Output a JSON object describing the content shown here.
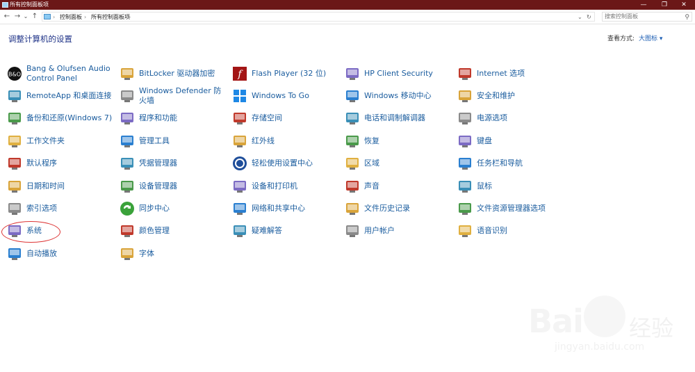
{
  "window": {
    "title": "所有控制面板项"
  },
  "nav": {
    "back": "←",
    "forward": "→",
    "recent": "⌄",
    "up": "↑"
  },
  "address": {
    "crumbs": [
      "控制面板",
      "所有控制面板项"
    ],
    "separator": "›",
    "dropdown": "⌄",
    "refresh": "↻"
  },
  "search": {
    "placeholder": "搜索控制面板"
  },
  "page": {
    "heading": "调整计算机的设置",
    "view_label": "查看方式:",
    "view_value": "大图标 ▾"
  },
  "items": [
    [
      "Bang & Olufsen Audio Control Panel",
      "BitLocker 驱动器加密",
      "Flash Player (32 位)",
      "HP Client Security",
      "Internet 选项"
    ],
    [
      "RemoteApp 和桌面连接",
      "Windows Defender 防火墙",
      "Windows To Go",
      "Windows 移动中心",
      "安全和维护"
    ],
    [
      "备份和还原(Windows 7)",
      "程序和功能",
      "存储空间",
      "电话和调制解调器",
      "电源选项"
    ],
    [
      "工作文件夹",
      "管理工具",
      "红外线",
      "恢复",
      "键盘"
    ],
    [
      "默认程序",
      "凭据管理器",
      "轻松使用设置中心",
      "区域",
      "任务栏和导航"
    ],
    [
      "日期和时间",
      "设备管理器",
      "设备和打印机",
      "声音",
      "鼠标"
    ],
    [
      "索引选项",
      "同步中心",
      "网络和共享中心",
      "文件历史记录",
      "文件资源管理器选项"
    ],
    [
      "系统",
      "颜色管理",
      "疑难解答",
      "用户帐户",
      "语音识别"
    ],
    [
      "自动播放",
      "字体"
    ]
  ],
  "icons": [
    [
      "bang-olufsen-icon",
      "bitlocker-key-icon",
      "flash-player-icon",
      "hp-shield-icon",
      "internet-globe-icon"
    ],
    [
      "remoteapp-icon",
      "firewall-wall-icon",
      "windows-to-go-icon",
      "mobility-center-icon",
      "security-flag-icon"
    ],
    [
      "backup-restore-icon",
      "programs-box-icon",
      "storage-drives-icon",
      "phone-modem-icon",
      "power-battery-icon"
    ],
    [
      "work-folder-icon",
      "admin-tools-icon",
      "infrared-icon",
      "recovery-icon",
      "keyboard-icon"
    ],
    [
      "default-programs-icon",
      "credential-safe-icon",
      "ease-of-access-icon",
      "region-globe-icon",
      "taskbar-icon"
    ],
    [
      "date-time-icon",
      "device-manager-icon",
      "printer-icon",
      "speaker-icon",
      "mouse-icon"
    ],
    [
      "indexing-icon",
      "sync-center-icon",
      "network-sharing-icon",
      "file-history-icon",
      "explorer-options-icon"
    ],
    [
      "system-laptop-icon",
      "color-management-icon",
      "troubleshoot-icon",
      "user-accounts-icon",
      "microphone-icon"
    ],
    [
      "autoplay-icon",
      "fonts-icon"
    ]
  ],
  "watermark": {
    "brand": "Bai",
    "brand2": "经验",
    "url": "jingyan.baidu.com"
  },
  "colors": {
    "titlebar": "#6b1717",
    "link": "#1a5c9e",
    "heading": "#1e3287",
    "annotation": "#dd3333"
  }
}
